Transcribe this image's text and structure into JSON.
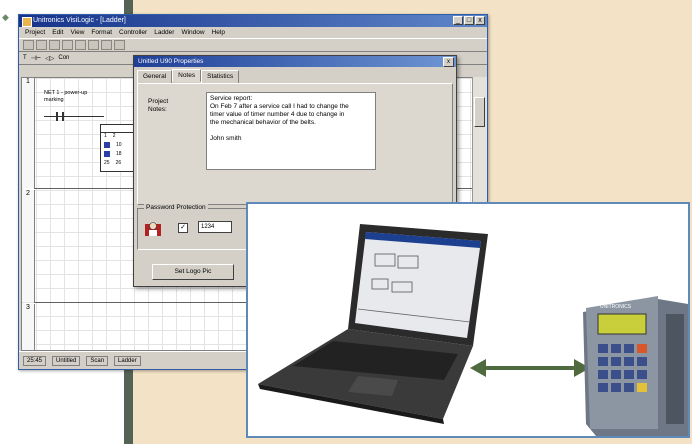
{
  "software": {
    "window_title": "Unitronics VisiLogic - [Ladder]",
    "menu": [
      "Project",
      "Edit",
      "View",
      "Format",
      "Controller",
      "Ladder",
      "Window",
      "Help"
    ],
    "toolbar2_label": "Con",
    "net_comment_line1": "NET 1 - power-up",
    "net_comment_line2": "marking",
    "rungs": [
      "1",
      "2",
      "3"
    ],
    "block_rows": [
      [
        "1",
        "2"
      ],
      [
        "",
        "10"
      ],
      [
        "",
        "18"
      ],
      [
        "25",
        "26"
      ]
    ],
    "status_items": [
      "Untitled",
      "Scan",
      "Ladder"
    ],
    "status_zoom": "25:45"
  },
  "dialog": {
    "title": "Unitled U90 Properties",
    "tabs": [
      "General",
      "Notes",
      "Statistics"
    ],
    "active_tab": "Notes",
    "project_notes_label": "Project Notes:",
    "notes_text_lines": [
      "Service report:",
      "On Feb 7 after a service call I had to change the",
      "timer value of timer number 4 due to change in",
      "the mechanical behavior of the belts.",
      "",
      "John smith"
    ],
    "password_group_label": "Password Protection",
    "password_value": "1234",
    "password_checked": "✓",
    "set_logo_button": "Set Logo Pic"
  },
  "photo": {
    "controller_label": "UNITRONICS"
  },
  "colors": {
    "panel": "#f3e2c6",
    "accent_bar": "#556356",
    "frame_border": "#5e89b8",
    "arrow": "#4f6a3e"
  }
}
